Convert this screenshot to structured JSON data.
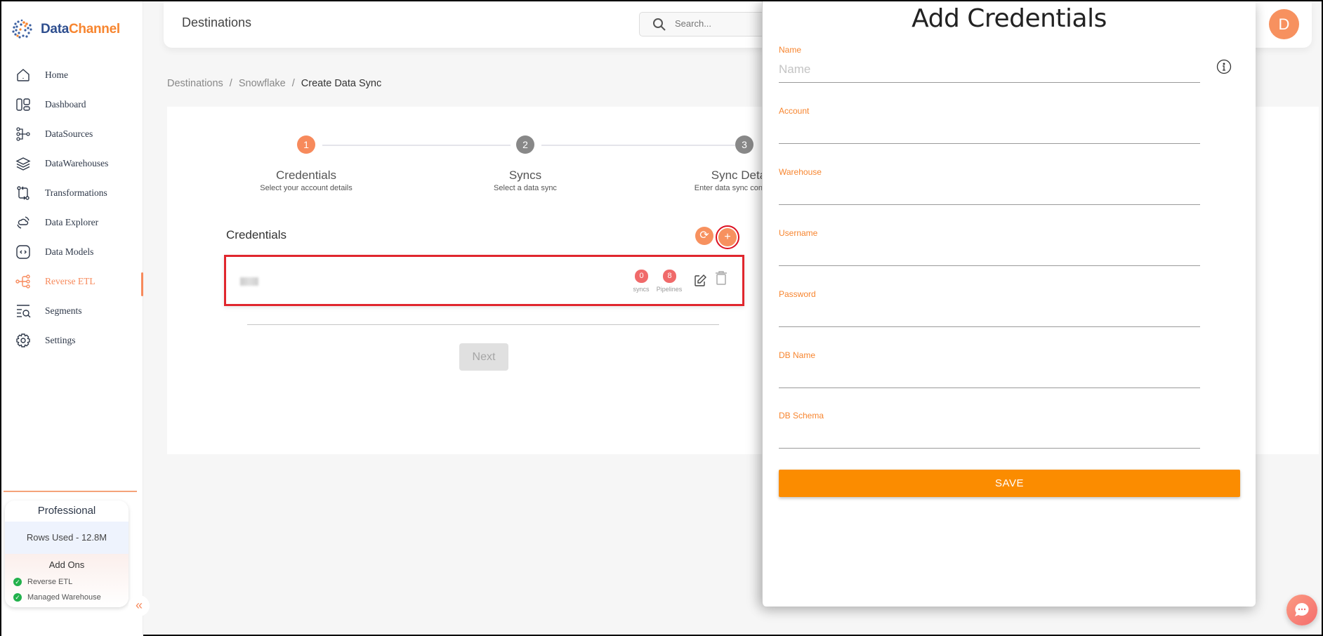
{
  "brand": {
    "name_part1": "Data",
    "name_part2": "Channel",
    "accent": "#f78a5c"
  },
  "sidebar": {
    "items": [
      {
        "label": "Home",
        "icon": "home-icon"
      },
      {
        "label": "Dashboard",
        "icon": "dashboard-icon"
      },
      {
        "label": "DataSources",
        "icon": "datasources-icon"
      },
      {
        "label": "DataWarehouses",
        "icon": "layers-icon"
      },
      {
        "label": "Transformations",
        "icon": "transform-icon"
      },
      {
        "label": "Data Explorer",
        "icon": "explorer-icon"
      },
      {
        "label": "Data Models",
        "icon": "code-icon"
      },
      {
        "label": "Reverse ETL",
        "icon": "reverse-etl-icon",
        "active": true
      },
      {
        "label": "Segments",
        "icon": "segments-icon"
      },
      {
        "label": "Settings",
        "icon": "gear-icon"
      }
    ],
    "plan": {
      "name": "Professional",
      "rows_used": "Rows Used - 12.8M",
      "addons_title": "Add Ons",
      "addons": [
        "Reverse ETL",
        "Managed Warehouse"
      ]
    }
  },
  "header": {
    "title": "Destinations",
    "search_placeholder": "Search...",
    "avatar_initial": "D"
  },
  "breadcrumb": [
    "Destinations",
    "Snowflake",
    "Create Data Sync"
  ],
  "stepper": [
    {
      "num": "1",
      "title": "Credentials",
      "subtitle": "Select your account details",
      "active": true
    },
    {
      "num": "2",
      "title": "Syncs",
      "subtitle": "Select a data sync",
      "active": false
    },
    {
      "num": "3",
      "title": "Sync Details",
      "subtitle": "Enter data sync configuration",
      "active": false
    }
  ],
  "credentials": {
    "title": "Credentials",
    "refresh_symbol": "⟳",
    "add_symbol": "+",
    "row": {
      "syncs_count": "0",
      "syncs_label": "syncs",
      "pipelines_count": "8",
      "pipelines_label": "Pipelines"
    },
    "next_label": "Next"
  },
  "panel": {
    "title": "Add Credentials",
    "fields": [
      {
        "label": "Name",
        "placeholder": "Name",
        "value": ""
      },
      {
        "label": "Account",
        "placeholder": "",
        "value": ""
      },
      {
        "label": "Warehouse",
        "placeholder": "",
        "value": ""
      },
      {
        "label": "Username",
        "placeholder": "",
        "value": ""
      },
      {
        "label": "Password",
        "placeholder": "",
        "value": ""
      },
      {
        "label": "DB Name",
        "placeholder": "",
        "value": ""
      },
      {
        "label": "DB Schema",
        "placeholder": "",
        "value": ""
      }
    ],
    "save_label": "SAVE",
    "save_color": "#fb8c00"
  }
}
